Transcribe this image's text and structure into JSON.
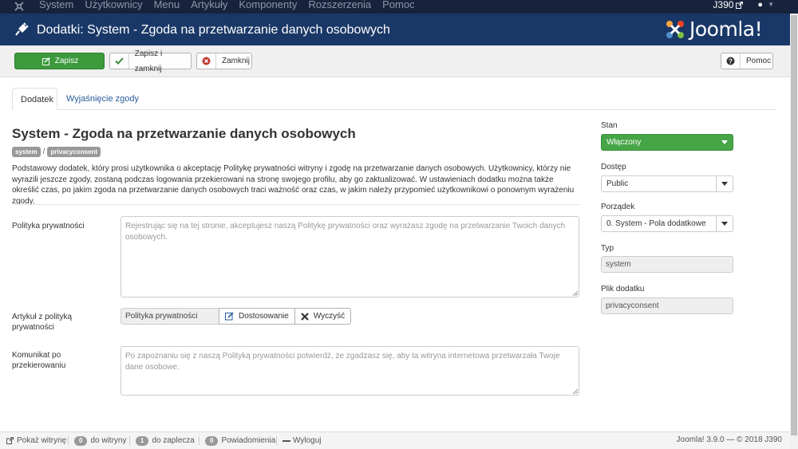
{
  "topnav": {
    "menu": [
      "System",
      "Użytkownicy",
      "Menu",
      "Artykuły",
      "Komponenty",
      "Rozszerzenia",
      "Pomoc"
    ],
    "site_name": "J390",
    "user_icon": "user-icon"
  },
  "header": {
    "title": "Dodatki: System - Zgoda na przetwarzanie danych osobowych",
    "brand": "Joomla!"
  },
  "toolbar": {
    "save": "Zapisz",
    "save_close": "Zapisz i zamknij",
    "close": "Zamknij",
    "help": "Pomoc"
  },
  "tabs": [
    "Dodatek",
    "Wyjaśnięcie zgody"
  ],
  "plugin": {
    "heading": "System - Zgoda na przetwarzanie danych osobowych",
    "group_label": "system",
    "element_label": "privacyconsent",
    "description": "Podstawowy dodatek, który prosi użytkownika o akceptację Politykę prywatności witryny i zgodę na przetwarzanie danych osobowych. Użytkownicy, którzy nie wyrazili jeszcze zgody, zostaną podczas logowania przekierowani na stronę swojego profilu, aby go zaktualizować. W ustawieniach dodatku można także określić czas, po jakim zgoda na przetwarzanie danych osobowych traci ważność oraz czas, w jakim należy przypomieć użytkownikowi o ponownym wyrażeniu zgody."
  },
  "fields": {
    "privacy_label": "Polityka prywatności",
    "privacy_placeholder": "Rejestrując się na tej stronie, akceptujesz naszą Politykę prywatności oraz wyrażasz zgodę na przetwarzanie Twoich danych osobowych.",
    "article_label": "Artykuł z polityką prywatności",
    "article_value": "Polityka prywatności",
    "edit_button": "Dostosowanie",
    "clear_button": "Wyczyść",
    "redirect_label": "Komunikat po przekierowaniu",
    "redirect_placeholder": "Po zapoznaniu się z naszą Polityką prywatności potwierdź, że zgadzasz się, aby ta witryna internetowa przetwarzała Twoje dane osobowe."
  },
  "sidebar": {
    "status_label": "Stan",
    "status_value": "Włączony",
    "access_label": "Dostęp",
    "access_value": "Public",
    "ordering_label": "Porządek",
    "ordering_value": "0. System - Pola dodatkowe",
    "type_label": "Typ",
    "type_value": "system",
    "file_label": "Plik dodatku",
    "file_value": "privacyconsent"
  },
  "statusbar": {
    "view_site": "Pokaż witrynę",
    "frontend_count": "0",
    "frontend_label": "do witryny",
    "backend_count": "1",
    "backend_label": "do zaplecza",
    "messages_count": "0",
    "messages_label": "Powiadomienia",
    "logout": "Wyloguj",
    "copyright": "Joomla! 3.9.0 — © 2018 J390"
  },
  "colors": {
    "topnav_bg": "#17233d",
    "header_bg": "#1a3867",
    "save_green": "#3d9a3d",
    "status_green": "#46a546",
    "link_blue": "#2a5b9c"
  }
}
